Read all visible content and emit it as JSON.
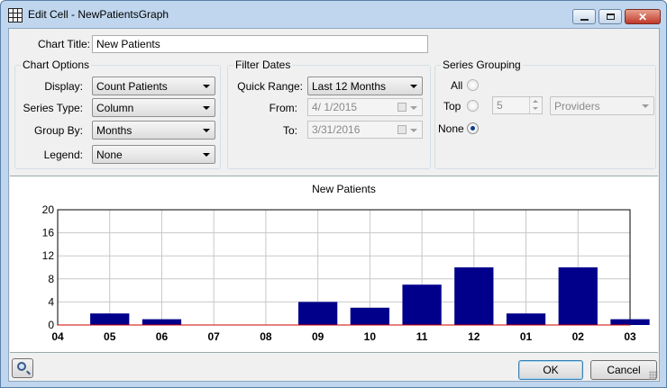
{
  "window": {
    "title": "Edit Cell - NewPatientsGraph"
  },
  "form": {
    "chart_title_label": "Chart Title:",
    "chart_title_value": "New Patients"
  },
  "chart_options": {
    "title": "Chart Options",
    "display_label": "Display:",
    "display_value": "Count Patients",
    "series_type_label": "Series Type:",
    "series_type_value": "Column",
    "group_by_label": "Group By:",
    "group_by_value": "Months",
    "legend_label": "Legend:",
    "legend_value": "None"
  },
  "filter_dates": {
    "title": "Filter Dates",
    "quick_range_label": "Quick Range:",
    "quick_range_value": "Last 12 Months",
    "from_label": "From:",
    "from_value": "4/  1/2015",
    "to_label": "To:",
    "to_value": "3/31/2016"
  },
  "series_grouping": {
    "title": "Series Grouping",
    "all_label": "All",
    "top_label": "Top",
    "none_label": "None",
    "top_count": "5",
    "group_value": "Providers",
    "selected": "None"
  },
  "buttons": {
    "ok": "OK",
    "cancel": "Cancel"
  },
  "colors": {
    "bar": "#00008b",
    "baseline": "#cc0000",
    "grid": "#c8c8c8"
  },
  "chart_data": {
    "type": "bar",
    "title": "New Patients",
    "categories": [
      "05",
      "06",
      "07",
      "08",
      "09",
      "10",
      "11",
      "12",
      "01",
      "02",
      "03"
    ],
    "x_start_tick": "04",
    "values": [
      2,
      1,
      0,
      0,
      4,
      3,
      7,
      10,
      2,
      10,
      1
    ],
    "ylim": [
      0,
      20
    ],
    "yticks": [
      0,
      4,
      8,
      12,
      16,
      20
    ],
    "grid": true,
    "legend": "none"
  }
}
